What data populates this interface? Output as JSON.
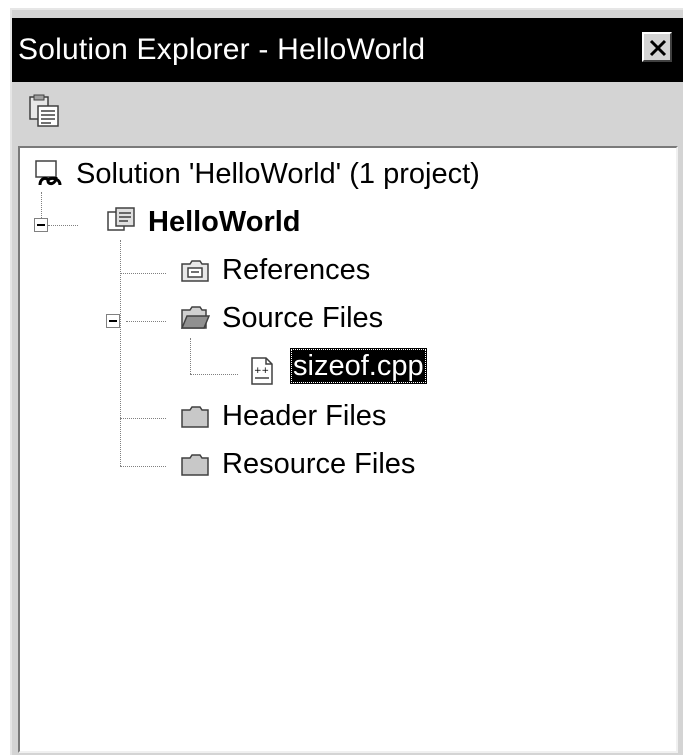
{
  "window": {
    "title": "Solution Explorer - HelloWorld",
    "close_icon": "close-icon"
  },
  "toolbar": {
    "properties_icon": "properties-icon"
  },
  "tree": {
    "solution": {
      "label": "Solution 'HelloWorld' (1 project)",
      "icon": "solution-icon"
    },
    "project": {
      "label": "HelloWorld",
      "icon": "project-icon",
      "expanded": true
    },
    "references": {
      "label": "References",
      "icon": "references-folder-icon"
    },
    "source_files": {
      "label": "Source Files",
      "icon": "open-folder-icon",
      "expanded": true
    },
    "source_file": {
      "label": "sizeof.cpp",
      "icon": "cpp-file-icon",
      "selected": true
    },
    "header_files": {
      "label": "Header Files",
      "icon": "folder-icon"
    },
    "resource_files": {
      "label": "Resource Files",
      "icon": "folder-icon"
    }
  },
  "colors": {
    "titlebar_bg": "#000000",
    "panel_bg": "#d4d4d4",
    "tree_bg": "#ffffff",
    "selection_bg": "#000000"
  }
}
